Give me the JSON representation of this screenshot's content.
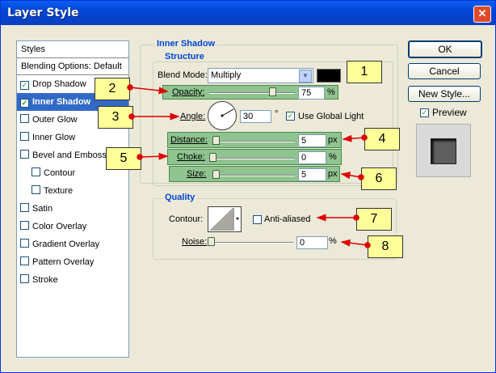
{
  "window": {
    "title": "Layer Style"
  },
  "styles_panel": {
    "header": "Styles",
    "blending": "Blending Options: Default",
    "items": [
      {
        "label": "Drop Shadow",
        "checked": true
      },
      {
        "label": "Inner Shadow",
        "checked": true,
        "selected": true
      },
      {
        "label": "Outer Glow",
        "checked": false
      },
      {
        "label": "Inner Glow",
        "checked": false
      },
      {
        "label": "Bevel and Emboss",
        "checked": false
      },
      {
        "label": "Contour",
        "checked": false
      },
      {
        "label": "Texture",
        "checked": false
      },
      {
        "label": "Satin",
        "checked": false
      },
      {
        "label": "Color Overlay",
        "checked": false
      },
      {
        "label": "Gradient Overlay",
        "checked": false
      },
      {
        "label": "Pattern Overlay",
        "checked": false
      },
      {
        "label": "Stroke",
        "checked": false
      }
    ]
  },
  "inner_shadow": {
    "title": "Inner Shadow",
    "structure": {
      "title": "Structure",
      "blend_mode_label": "Blend Mode:",
      "blend_mode_value": "Multiply",
      "color": "#000000",
      "opacity_label": "Opacity:",
      "opacity_value": "75",
      "opacity_unit": "%",
      "angle_label": "Angle:",
      "angle_value": "30",
      "angle_unit": "°",
      "global_light_label": "Use Global Light",
      "global_light_checked": true,
      "distance_label": "Distance:",
      "distance_value": "5",
      "distance_unit": "px",
      "choke_label": "Choke:",
      "choke_value": "0",
      "choke_unit": "%",
      "size_label": "Size:",
      "size_value": "5",
      "size_unit": "px"
    },
    "quality": {
      "title": "Quality",
      "contour_label": "Contour:",
      "anti_aliased_label": "Anti-aliased",
      "anti_aliased_checked": false,
      "noise_label": "Noise:",
      "noise_value": "0",
      "noise_unit": "%"
    }
  },
  "buttons": {
    "ok": "OK",
    "cancel": "Cancel",
    "new_style": "New Style...",
    "preview_label": "Preview",
    "preview_checked": true
  },
  "callouts": [
    "1",
    "2",
    "3",
    "4",
    "5",
    "6",
    "7",
    "8"
  ],
  "colors": {
    "highlight": "#8fc38f",
    "callout": "#ffff99",
    "arrow": "#dd0000",
    "selection": "#316ac5",
    "title_bar": "#0346d6"
  }
}
